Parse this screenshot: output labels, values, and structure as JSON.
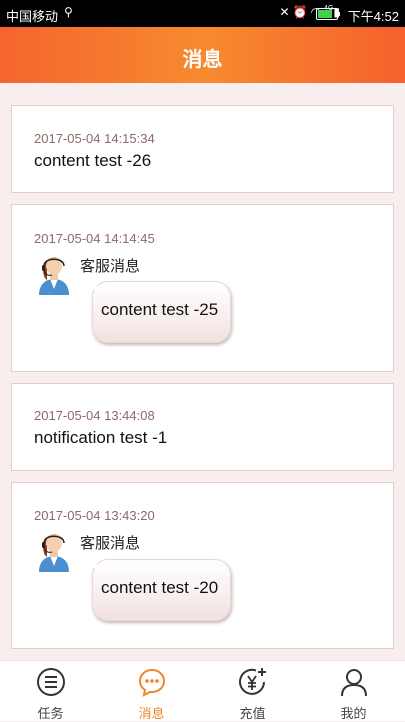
{
  "status_bar": {
    "carrier": "中国移动",
    "usb_icon": "usb-icon",
    "signal_label": "4G",
    "time": "下午4:52",
    "colors": {
      "battery": "#3fd34b"
    }
  },
  "header": {
    "title": "消息",
    "colors": {
      "gradient_start": "#f5642e",
      "gradient_end": "#f78a2f"
    }
  },
  "messages": [
    {
      "time": "2017-05-04 14:15:34",
      "type": "notification",
      "content": "content test -26"
    },
    {
      "time": "2017-05-04 14:14:45",
      "type": "service",
      "sender": "客服消息",
      "content": "content test -25"
    },
    {
      "time": "2017-05-04 13:44:08",
      "type": "notification",
      "content": "notification test -1"
    },
    {
      "time": "2017-05-04 13:43:20",
      "type": "service",
      "sender": "客服消息",
      "content": "content test -20"
    }
  ],
  "tabs": [
    {
      "label": "任务",
      "icon": "list-icon",
      "active": false
    },
    {
      "label": "消息",
      "icon": "chat-icon",
      "active": true
    },
    {
      "label": "充值",
      "icon": "yuan-add-icon",
      "active": false
    },
    {
      "label": "我的",
      "icon": "person-icon",
      "active": false
    }
  ],
  "colors": {
    "accent": "#f0862a",
    "background": "#f7eeed"
  }
}
